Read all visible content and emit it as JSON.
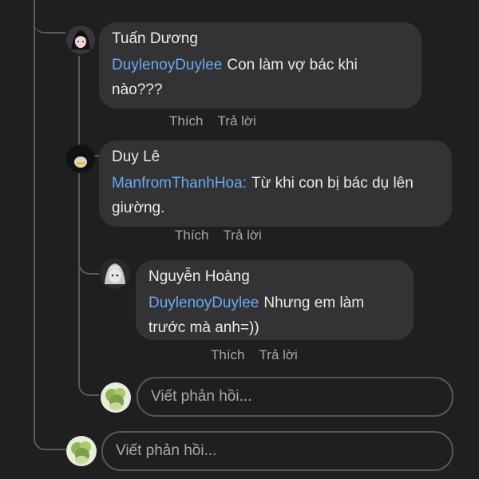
{
  "comments": [
    {
      "author": "Tuấn Dương",
      "mention": "DuylenoyDuylee",
      "text": "Con làm vợ bác khi nào???",
      "like": "Thích",
      "reply": "Trả lời"
    },
    {
      "author": "Duy Lê",
      "mention": "ManfromThanhHoa:",
      "text": "Từ khi con bị bác dụ lên giường.",
      "like": "Thích",
      "reply": "Trả lời"
    },
    {
      "author": "Nguyễn Hoàng",
      "mention": "DuylenoyDuylee",
      "text": "Nhưng em làm trước mà anh=))",
      "like": "Thích",
      "reply": "Trả lời"
    }
  ],
  "reply_inputs": [
    {
      "placeholder": "Viết phản hồi..."
    },
    {
      "placeholder": "Viết phản hồi..."
    }
  ],
  "colors": {
    "background": "#1f1f1f",
    "bubble": "#333335",
    "mention": "#6aaaf3",
    "line": "#5a5a5a"
  }
}
